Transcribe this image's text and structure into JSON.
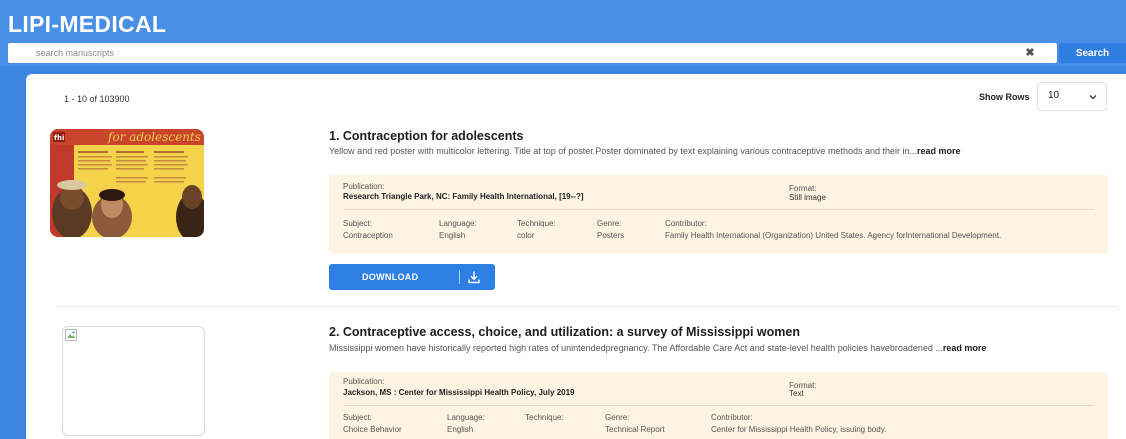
{
  "app": {
    "title": "LIPI-MEDICAL"
  },
  "search": {
    "placeholder": "search manuscripts",
    "clear_icon": "close-icon",
    "button_label": "Search"
  },
  "results": {
    "count_text": "1 - 10 of 103900",
    "show_rows_label": "Show Rows",
    "rows_value": "10"
  },
  "items": [
    {
      "title": "1. Contraception for adolescents",
      "description": "Yellow and red poster with multicolor lettering. Title at top of poster.Poster dominated by text explaining various contraceptive methods and their in...",
      "read_more": "read more",
      "thumbnail_text": "for adolescents",
      "publication_label": "Publication:",
      "publication": "Research Triangle Park, NC: Family Health International, [19--?]",
      "format_label": "Format:",
      "format": "Still image",
      "subject_label": "Subject:",
      "subject": "Contraception",
      "language_label": "Language:",
      "language": "English",
      "technique_label": "Technique:",
      "technique": "color",
      "genre_label": "Genre:",
      "genre": "Posters",
      "contributor_label": "Contributor:",
      "contributor": "Family Health International (Organization) United States. Agency forInternational Development.",
      "download_label": "DOWNLOAD"
    },
    {
      "title": "2. Contraceptive access, choice, and utilization: a survey of Mississippi women",
      "description": "Mississippi women have historically reported high rates of unintendedpregnancy. The Affordable Care Act and state-level health policies havebroadened ...",
      "read_more": "read more",
      "publication_label": "Publication:",
      "publication": "Jackson, MS : Center for Mississippi Health Policy, July 2019",
      "format_label": "Format:",
      "format": "Text",
      "subject_label": "Subject:",
      "subject": "Choice Behavior",
      "language_label": "Language:",
      "language": "English",
      "technique_label": "Technique:",
      "genre_label": "Genre:",
      "genre": "Technical Report",
      "contributor_label": "Contributor:",
      "contributor": "Center for Mississippi Health Policy, issuing body."
    }
  ],
  "colors": {
    "header": "#4a8fe6",
    "accent": "#2d7fe3",
    "meta_bg": "#fdf4e3"
  }
}
